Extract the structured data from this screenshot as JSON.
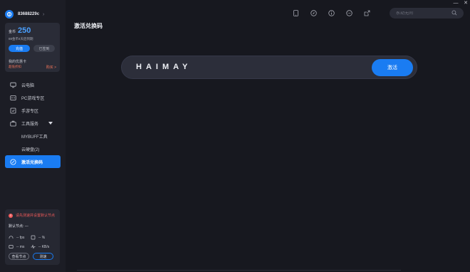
{
  "user": {
    "id": "83688229c"
  },
  "gold": {
    "label": "金币",
    "value": "250",
    "expiry": "88金币4天后到期",
    "recharge_label": "充值",
    "signed_label": "已签到"
  },
  "coupon": {
    "title": "我的优惠卡",
    "subtitle": "超低折扣",
    "buy_label": "购买 >"
  },
  "nav": {
    "cloud_pc": "云电脑",
    "pc_games": "PC游戏专区",
    "mobile_games": "手游专区",
    "tools": "工具服务",
    "mybuff_tool": "MYBUFF工具",
    "cloud_disk": "云硬盘(2)",
    "redeem": "激活兑换码"
  },
  "node": {
    "warning": "请先测速并设置默认节点",
    "default_label": "默认节点: ---",
    "fps": "-- fps",
    "percent": "-- %",
    "ms": "-- ms",
    "kbps": "-- KB/s",
    "check_label": "查看节点",
    "speed_label": "测速"
  },
  "main": {
    "title": "激活兑换码",
    "code_value": "HAIMAY",
    "activate_label": "激活",
    "search_placeholder": "永劫无间"
  },
  "window": {
    "minimize": "—",
    "close": "✕"
  },
  "icons": {
    "top": [
      "tablet-icon",
      "compass-icon",
      "info-icon",
      "chat-icon",
      "external-link-icon"
    ]
  },
  "colors": {
    "accent": "#1a7cf2",
    "warning": "#f05a5a",
    "promo": "#f0745a"
  }
}
